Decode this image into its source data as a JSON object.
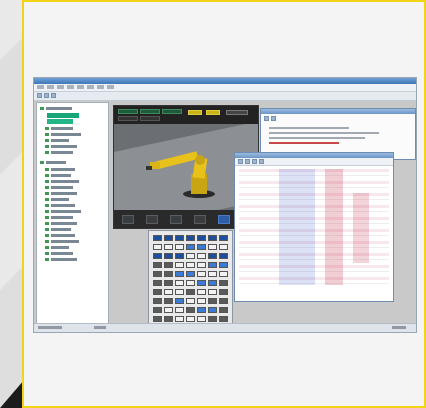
{
  "page": {
    "accent_color": "#f3d316",
    "background_color": "#f4f4f4",
    "decoration_color": "#1b1b1b"
  },
  "screenshot": {
    "description_icons": [
      "window-titlebar",
      "menu-bar",
      "toolbar",
      "project-tree",
      "3d-viewport",
      "teach-pendant",
      "program-editor-window",
      "variable-table-window",
      "status-bar"
    ],
    "viewport": {
      "robot_color": "#e8c21a",
      "floor_color": "#8c8f93"
    },
    "tree": {
      "selected_color": "#17a57a"
    }
  }
}
